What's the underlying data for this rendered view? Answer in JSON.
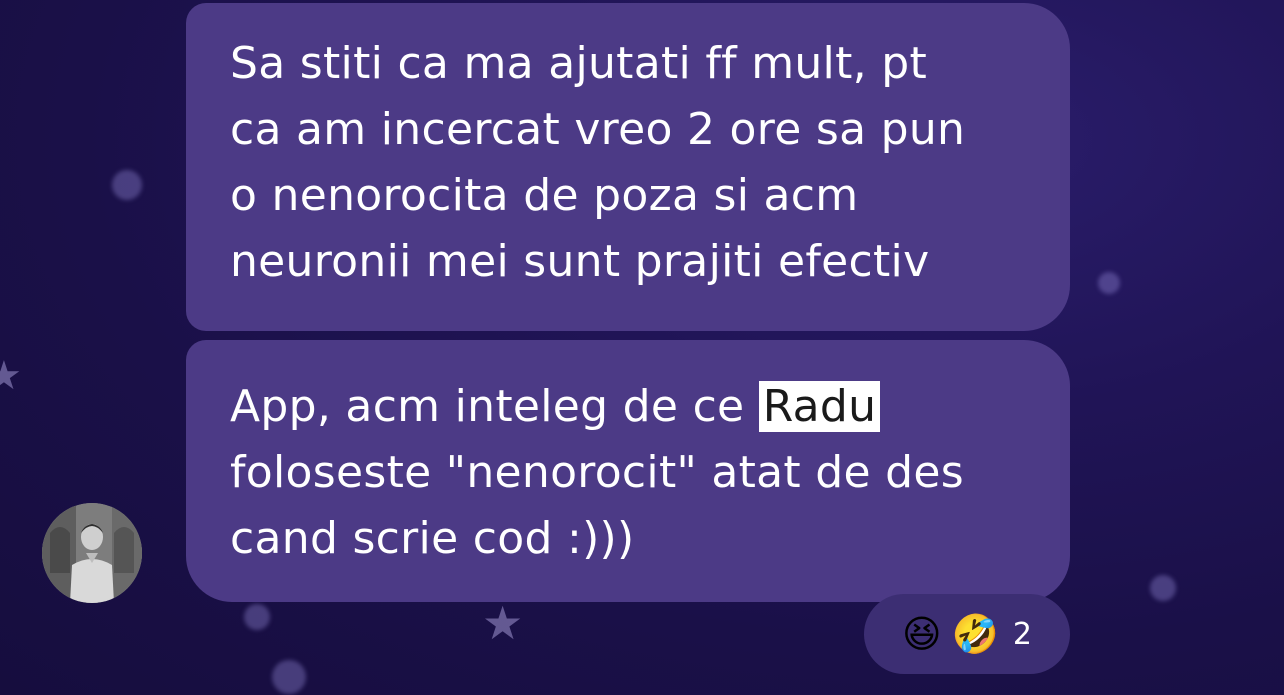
{
  "messages": [
    {
      "lines": [
        "Sa stiti ca ma ajutati ff mult, pt",
        "ca am incercat vreo 2 ore sa pun",
        "o nenorocita de poza si acm",
        "neuronii mei sunt prajiti efectiv"
      ]
    },
    {
      "line1_before": "App, acm inteleg de ce ",
      "line1_highlight": "Radu",
      "line2": "foloseste \"nenorocit\" atat de des",
      "line3": "cand scrie cod :)))"
    }
  ],
  "reactions": {
    "emoji_1": "😆",
    "emoji_2": "🤣",
    "count": "2"
  },
  "colors": {
    "bubble": "#4c3a86",
    "reaction_pill": "#3c2e73",
    "background": "#1d1250",
    "highlight": "#ffffff"
  }
}
